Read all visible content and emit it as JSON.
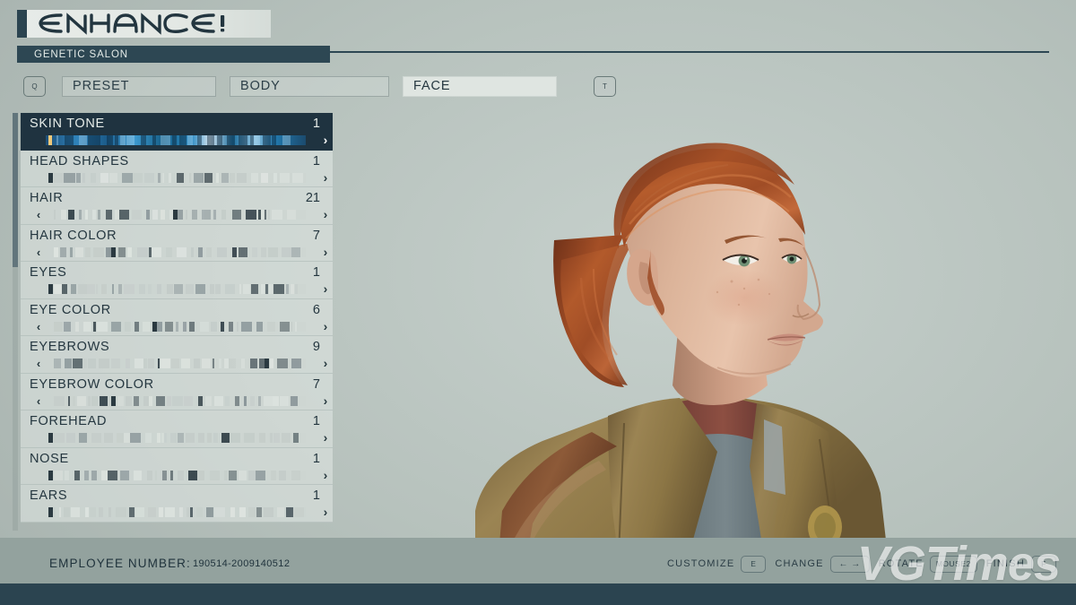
{
  "header": {
    "logo": "ENHANCE!",
    "subtitle": "GENETIC SALON"
  },
  "tabs": {
    "left_key": "Q",
    "right_key": "T",
    "items": [
      {
        "label": "PRESET",
        "active": false
      },
      {
        "label": "BODY",
        "active": false
      },
      {
        "label": "FACE",
        "active": true
      }
    ]
  },
  "list": {
    "rows": [
      {
        "label": "SKIN TONE",
        "value": "1",
        "selected": true,
        "has_left_arrow": false,
        "cursor_pct": 1
      },
      {
        "label": "HEAD SHAPES",
        "value": "1",
        "selected": false,
        "has_left_arrow": false,
        "cursor_pct": 1
      },
      {
        "label": "HAIR",
        "value": "21",
        "selected": false,
        "has_left_arrow": true,
        "cursor_pct": 49
      },
      {
        "label": "HAIR COLOR",
        "value": "7",
        "selected": false,
        "has_left_arrow": true,
        "cursor_pct": 25
      },
      {
        "label": "EYES",
        "value": "1",
        "selected": false,
        "has_left_arrow": false,
        "cursor_pct": 1
      },
      {
        "label": "EYE COLOR",
        "value": "6",
        "selected": false,
        "has_left_arrow": true,
        "cursor_pct": 41
      },
      {
        "label": "EYEBROWS",
        "value": "9",
        "selected": false,
        "has_left_arrow": true,
        "cursor_pct": 84
      },
      {
        "label": "EYEBROW COLOR",
        "value": "7",
        "selected": false,
        "has_left_arrow": true,
        "cursor_pct": 25
      },
      {
        "label": "FOREHEAD",
        "value": "1",
        "selected": false,
        "has_left_arrow": false,
        "cursor_pct": 1
      },
      {
        "label": "NOSE",
        "value": "1",
        "selected": false,
        "has_left_arrow": false,
        "cursor_pct": 1
      },
      {
        "label": "EARS",
        "value": "1",
        "selected": false,
        "has_left_arrow": false,
        "cursor_pct": 1
      }
    ],
    "arrow_right_glyph": "›",
    "arrow_left_glyph": "‹"
  },
  "footer": {
    "employee_label": "EMPLOYEE NUMBER:",
    "employee_number": "190514-2009140512",
    "hints": [
      {
        "label": "CUSTOMIZE",
        "key": "E",
        "style": "normal"
      },
      {
        "label": "CHANGE",
        "key": "← →",
        "style": "arrows"
      },
      {
        "label": "ROTATE",
        "key": "MOUSE2",
        "style": "wide"
      },
      {
        "label": "FINISH",
        "key": "F",
        "style": "normal"
      }
    ]
  },
  "watermark": {
    "text": "VGTimes"
  },
  "colors": {
    "background": "#b7c2bd",
    "panel_row": "#dde4e0",
    "selected_row": "#1f3340",
    "accent_dark": "#2d4753",
    "bottom_bar": "#93a29e",
    "letterbox": "#2b4450",
    "text_dark": "#24363f",
    "cursor_gold": "#f0c97a"
  }
}
